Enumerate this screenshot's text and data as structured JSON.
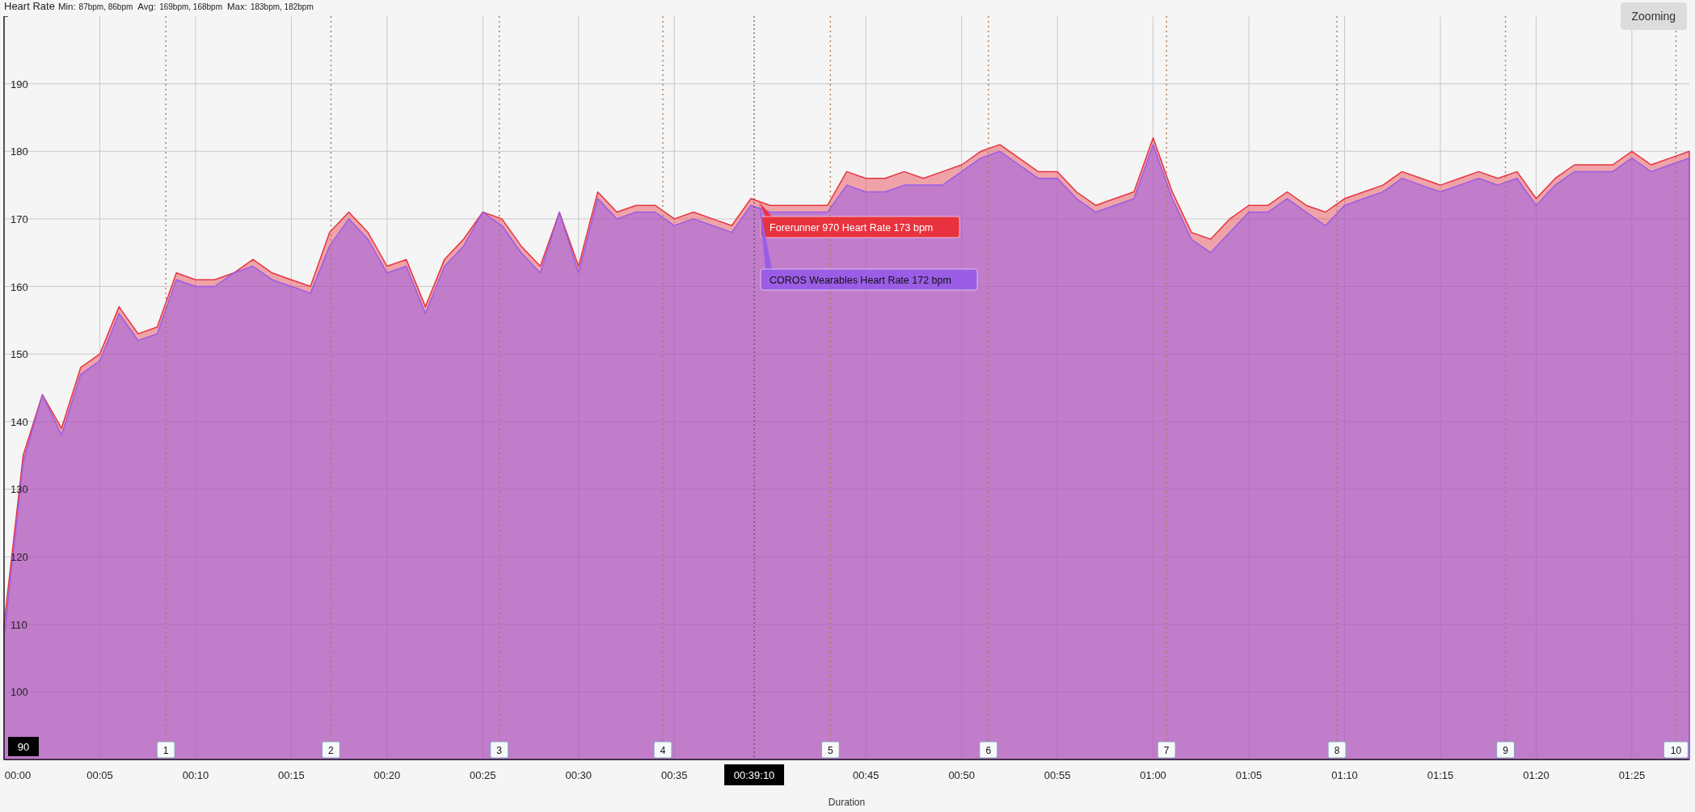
{
  "chart": {
    "title": "Heart Rate",
    "stats": [
      {
        "label": "Min:",
        "value": "87bpm, 86bpm"
      },
      {
        "label": "Avg:",
        "value": "169bpm, 168bpm"
      },
      {
        "label": "Max:",
        "value": "183bpm, 182bpm"
      }
    ],
    "zoom_button": "Zooming",
    "chart_data": {
      "type": "area",
      "xlabel": "Duration",
      "xlim": [
        0,
        88
      ],
      "ylim": [
        90,
        200
      ],
      "grid": true,
      "stacked": false,
      "x": [
        0,
        1,
        2,
        3,
        4,
        5,
        6,
        7,
        8,
        9,
        10,
        11,
        12,
        13,
        14,
        15,
        16,
        17,
        18,
        19,
        20,
        21,
        22,
        23,
        24,
        25,
        26,
        27,
        28,
        29,
        30,
        31,
        32,
        33,
        34,
        35,
        36,
        37,
        38,
        39,
        40,
        41,
        42,
        43,
        44,
        45,
        46,
        47,
        48,
        49,
        50,
        51,
        52,
        53,
        54,
        55,
        56,
        57,
        58,
        59,
        60,
        61,
        62,
        63,
        64,
        65,
        66,
        67,
        68,
        69,
        70,
        71,
        72,
        73,
        74,
        75,
        76,
        77,
        78,
        79,
        80,
        81,
        82,
        83,
        84,
        85,
        86,
        87,
        88
      ],
      "series": [
        {
          "name": "Forerunner 970 Heart Rate",
          "color": "#e8333f",
          "values": [
            110,
            135,
            144,
            139,
            148,
            150,
            157,
            153,
            154,
            162,
            161,
            161,
            162,
            164,
            162,
            161,
            160,
            168,
            171,
            168,
            163,
            164,
            157,
            164,
            167,
            171,
            170,
            166,
            163,
            171,
            163,
            174,
            171,
            172,
            172,
            170,
            171,
            170,
            169,
            173,
            172,
            172,
            172,
            172,
            177,
            176,
            176,
            177,
            176,
            177,
            178,
            180,
            181,
            179,
            177,
            177,
            174,
            172,
            173,
            174,
            182,
            174,
            168,
            167,
            170,
            172,
            172,
            174,
            172,
            171,
            173,
            174,
            175,
            177,
            176,
            175,
            176,
            177,
            176,
            177,
            173,
            176,
            178,
            178,
            178,
            180,
            178,
            179,
            180
          ]
        },
        {
          "name": "COROS Wearables Heart Rate",
          "color": "#9b5de5",
          "values": [
            108,
            134,
            144,
            138,
            147,
            149,
            156,
            152,
            153,
            161,
            160,
            160,
            162,
            163,
            161,
            160,
            159,
            166,
            170,
            167,
            162,
            163,
            156,
            163,
            166,
            171,
            169,
            165,
            162,
            171,
            162,
            173,
            170,
            171,
            171,
            169,
            170,
            169,
            168,
            172,
            171,
            171,
            171,
            171,
            175,
            174,
            174,
            175,
            175,
            175,
            177,
            179,
            180,
            178,
            176,
            176,
            173,
            171,
            172,
            173,
            181,
            173,
            167,
            165,
            168,
            171,
            171,
            173,
            171,
            169,
            172,
            173,
            174,
            176,
            175,
            174,
            175,
            176,
            175,
            176,
            172,
            175,
            177,
            177,
            177,
            179,
            177,
            178,
            179
          ]
        }
      ],
      "xticks": [
        {
          "value": 0,
          "label": "00:00"
        },
        {
          "value": 5,
          "label": "00:05"
        },
        {
          "value": 10,
          "label": "00:10"
        },
        {
          "value": 15,
          "label": "00:15"
        },
        {
          "value": 20,
          "label": "00:20"
        },
        {
          "value": 25,
          "label": "00:25"
        },
        {
          "value": 30,
          "label": "00:30"
        },
        {
          "value": 35,
          "label": "00:35"
        },
        {
          "value": 45,
          "label": "00:45"
        },
        {
          "value": 50,
          "label": "00:50"
        },
        {
          "value": 55,
          "label": "00:55"
        },
        {
          "value": 60,
          "label": "01:00"
        },
        {
          "value": 65,
          "label": "01:05"
        },
        {
          "value": 70,
          "label": "01:10"
        },
        {
          "value": 75,
          "label": "01:15"
        },
        {
          "value": 80,
          "label": "01:20"
        },
        {
          "value": 85,
          "label": "01:25"
        }
      ],
      "yticks": [
        100,
        110,
        120,
        130,
        140,
        150,
        160,
        170,
        180,
        190
      ],
      "ref_lines": [
        {
          "axis": "x",
          "value": 8.45
        },
        {
          "axis": "x",
          "value": 17.07
        },
        {
          "axis": "x",
          "value": 25.86
        },
        {
          "axis": "x",
          "value": 34.4
        },
        {
          "axis": "x",
          "value": 43.15
        },
        {
          "axis": "x",
          "value": 51.4
        },
        {
          "axis": "x",
          "value": 60.7
        },
        {
          "axis": "x",
          "value": 69.6
        },
        {
          "axis": "x",
          "value": 78.4
        },
        {
          "axis": "x",
          "value": 87.3
        },
        {
          "axis": "x",
          "value": 39.17
        }
      ],
      "annotations": [
        "00:39:10"
      ]
    },
    "laps": [
      {
        "label": "1"
      },
      {
        "label": "2"
      },
      {
        "label": "3"
      },
      {
        "label": "4"
      },
      {
        "label": "5"
      },
      {
        "label": "6"
      },
      {
        "label": "7"
      },
      {
        "label": "8"
      },
      {
        "label": "9"
      },
      {
        "label": "10"
      }
    ],
    "crosshair": {
      "y_label": "90",
      "tooltips": [
        {
          "value": "173 bpm"
        },
        {
          "value": "172 bpm"
        }
      ]
    }
  }
}
